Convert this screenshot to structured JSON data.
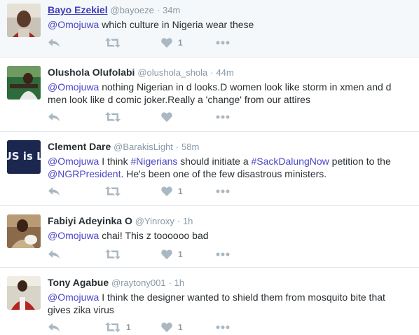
{
  "tweets": [
    {
      "name": "Bayo Ezekiel",
      "handle": "@bayoeze",
      "time": "34m",
      "segments": [
        {
          "text": "@Omojuwa",
          "link": true
        },
        {
          "text": " which culture in Nigeria wear these",
          "link": false
        }
      ],
      "retweets": "",
      "likes": "1"
    },
    {
      "name": "Olushola Olufolabi",
      "handle": "@olushola_shola",
      "time": "44m",
      "segments": [
        {
          "text": "@Omojuwa",
          "link": true
        },
        {
          "text": " nothing Nigerian in d looks.D women look like storm in xmen and d men look like d comic joker.Really a 'change' from our attires",
          "link": false
        }
      ],
      "retweets": "",
      "likes": ""
    },
    {
      "name": "Clement Dare",
      "handle": "@BarakisLight",
      "time": "58m",
      "segments": [
        {
          "text": "@Omojuwa",
          "link": true
        },
        {
          "text": " I think ",
          "link": false
        },
        {
          "text": "#Nigerians",
          "link": true
        },
        {
          "text": " should initiate a ",
          "link": false
        },
        {
          "text": "#SackDalungNow",
          "link": true
        },
        {
          "text": " petition to the ",
          "link": false
        },
        {
          "text": "@NGRPresident",
          "link": true
        },
        {
          "text": ". He's been one of the few disastrous ministers.",
          "link": false
        }
      ],
      "retweets": "",
      "likes": "1"
    },
    {
      "name": "Fabiyi Adeyinka O",
      "handle": "@Yinroxy",
      "time": "1h",
      "segments": [
        {
          "text": "@Omojuwa",
          "link": true
        },
        {
          "text": " chai! This z toooooo bad",
          "link": false
        }
      ],
      "retweets": "",
      "likes": "1"
    },
    {
      "name": "Tony Agabue",
      "handle": "@raytony001",
      "time": "1h",
      "segments": [
        {
          "text": "@Omojuwa",
          "link": true
        },
        {
          "text": " I think the designer wanted to shield them from mosquito bite that gives zika virus",
          "link": false
        }
      ],
      "retweets": "1",
      "likes": "1"
    }
  ],
  "avatar_badge_text": "JESUS is Lord",
  "separator": "·",
  "icons": {
    "reply": "reply-icon",
    "retweet": "retweet-icon",
    "like": "heart-icon",
    "more": "more-dots-icon"
  },
  "colors": {
    "link": "#4b45c5",
    "name_link": "#3b3bb8",
    "muted": "#8899a6",
    "icon": "#aab8c2",
    "divider": "#e1e8ed",
    "highlight_bg": "#f5f8fa"
  }
}
